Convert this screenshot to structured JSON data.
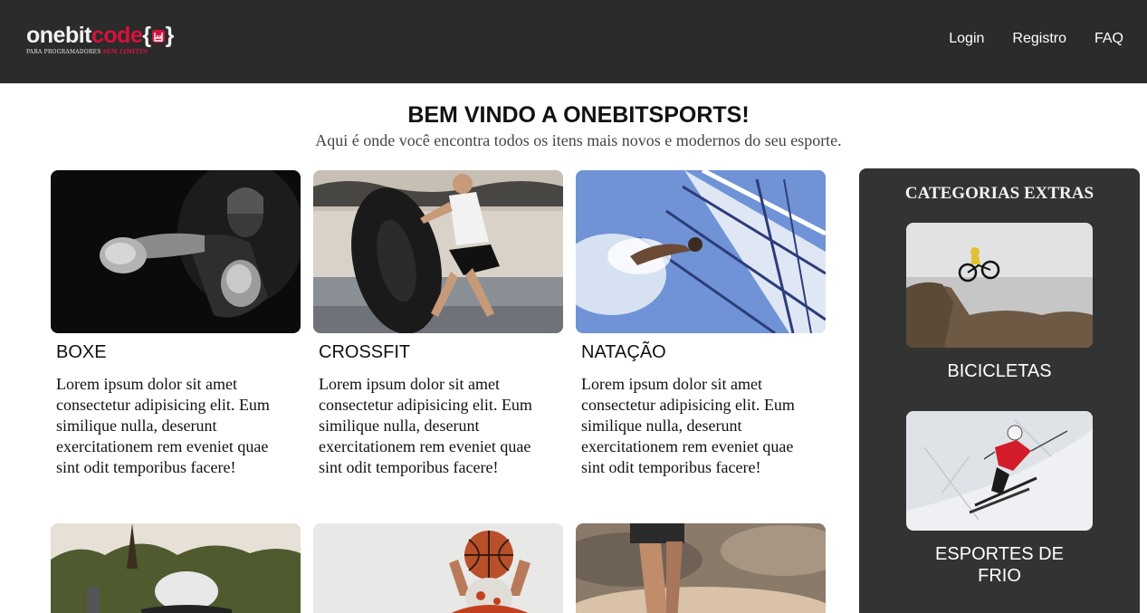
{
  "header": {
    "logo": {
      "word_white": "onebit",
      "word_red": "code",
      "brace_open": "{",
      "brace_close": "}",
      "tagline": "PARA PROGRAMADORES",
      "tagline_red": "SEM LIMITES"
    },
    "nav": [
      {
        "label": "Login"
      },
      {
        "label": "Registro"
      },
      {
        "label": "FAQ"
      }
    ]
  },
  "hero": {
    "title": "BEM VINDO A ONEBITSPORTS!",
    "subtitle": "Aqui é onde você encontra todos os itens mais novos e modernos do seu esporte."
  },
  "cards": [
    {
      "title": "BOXE",
      "text": "Lorem ipsum dolor sit amet consectetur adipisicing elit. Eum similique nulla, deserunt exercitationem rem eveniet quae sint odit temporibus facere!",
      "image": "boxing-image"
    },
    {
      "title": "CROSSFIT",
      "text": "Lorem ipsum dolor sit amet consectetur adipisicing elit. Eum similique nulla, deserunt exercitationem rem eveniet quae sint odit temporibus facere!",
      "image": "crossfit-image"
    },
    {
      "title": "NATAÇÃO",
      "text": "Lorem ipsum dolor sit amet consectetur adipisicing elit. Eum similique nulla, deserunt exercitationem rem eveniet quae sint odit temporibus facere!",
      "image": "swimming-image"
    }
  ],
  "bottom_cards": [
    {
      "image": "workout-outdoor-image"
    },
    {
      "image": "basketball-image"
    },
    {
      "image": "running-image"
    }
  ],
  "sidebar": {
    "title": "CATEGORIAS EXTRAS",
    "items": [
      {
        "label": "BICICLETAS",
        "image": "bicycle-image"
      },
      {
        "label": "ESPORTES DE FRIO",
        "image": "ski-image"
      }
    ]
  },
  "colors": {
    "header_bg": "#2b2b2b",
    "brand_red": "#d6123d",
    "sidebar_bg": "#333333"
  }
}
